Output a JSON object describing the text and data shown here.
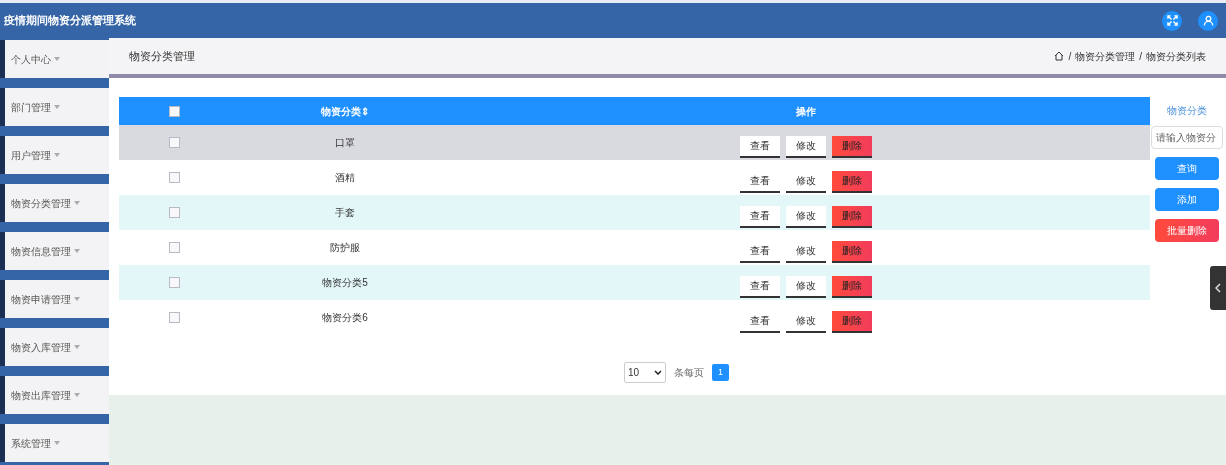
{
  "header": {
    "title": "疫情期间物资分派管理系统"
  },
  "sidebar": {
    "items": [
      {
        "label": "个人中心"
      },
      {
        "label": "部门管理"
      },
      {
        "label": "用户管理"
      },
      {
        "label": "物资分类管理"
      },
      {
        "label": "物资信息管理"
      },
      {
        "label": "物资申请管理"
      },
      {
        "label": "物资入库管理"
      },
      {
        "label": "物资出库管理"
      },
      {
        "label": "系统管理"
      }
    ]
  },
  "page_title": "物资分类管理",
  "breadcrumb": [
    {
      "separator": "/",
      "label": "物资分类管理"
    },
    {
      "separator": "/",
      "label": "物资分类列表"
    }
  ],
  "table": {
    "select_all_checked": false,
    "columns": [
      "物资分类",
      "操作"
    ],
    "sort_mark": "⇕",
    "rows": [
      {
        "name": "口罩",
        "checked": false,
        "hovered": true,
        "actions": [
          {
            "label": "查看",
            "kind": "plain"
          },
          {
            "label": "修改",
            "kind": "plain"
          },
          {
            "label": "删除",
            "kind": "danger"
          }
        ]
      },
      {
        "name": "酒精",
        "checked": false,
        "hovered": false,
        "actions": [
          {
            "label": "查看",
            "kind": "plain"
          },
          {
            "label": "修改",
            "kind": "plain"
          },
          {
            "label": "删除",
            "kind": "danger"
          }
        ]
      },
      {
        "name": "手套",
        "checked": false,
        "hovered": false,
        "actions": [
          {
            "label": "查看",
            "kind": "plain"
          },
          {
            "label": "修改",
            "kind": "plain"
          },
          {
            "label": "删除",
            "kind": "danger"
          }
        ]
      },
      {
        "name": "防护服",
        "checked": false,
        "hovered": false,
        "actions": [
          {
            "label": "查看",
            "kind": "plain"
          },
          {
            "label": "修改",
            "kind": "plain"
          },
          {
            "label": "删除",
            "kind": "danger"
          }
        ]
      },
      {
        "name": "物资分类5",
        "checked": false,
        "hovered": false,
        "actions": [
          {
            "label": "查看",
            "kind": "plain"
          },
          {
            "label": "修改",
            "kind": "plain"
          },
          {
            "label": "删除",
            "kind": "danger"
          }
        ]
      },
      {
        "name": "物资分类6",
        "checked": false,
        "hovered": false,
        "actions": [
          {
            "label": "查看",
            "kind": "plain"
          },
          {
            "label": "修改",
            "kind": "plain"
          },
          {
            "label": "删除",
            "kind": "danger"
          }
        ]
      }
    ]
  },
  "pagination": {
    "page_size": "10",
    "per_page_label": "条每页",
    "pages": [
      {
        "label": "1",
        "selected": true
      }
    ]
  },
  "search_panel": {
    "label": "物资分类",
    "placeholder": "请输入物资分",
    "buttons": [
      {
        "label": "查询",
        "kind": "primary"
      },
      {
        "label": "添加",
        "kind": "primary"
      },
      {
        "label": "批量删除",
        "kind": "danger"
      }
    ]
  }
}
